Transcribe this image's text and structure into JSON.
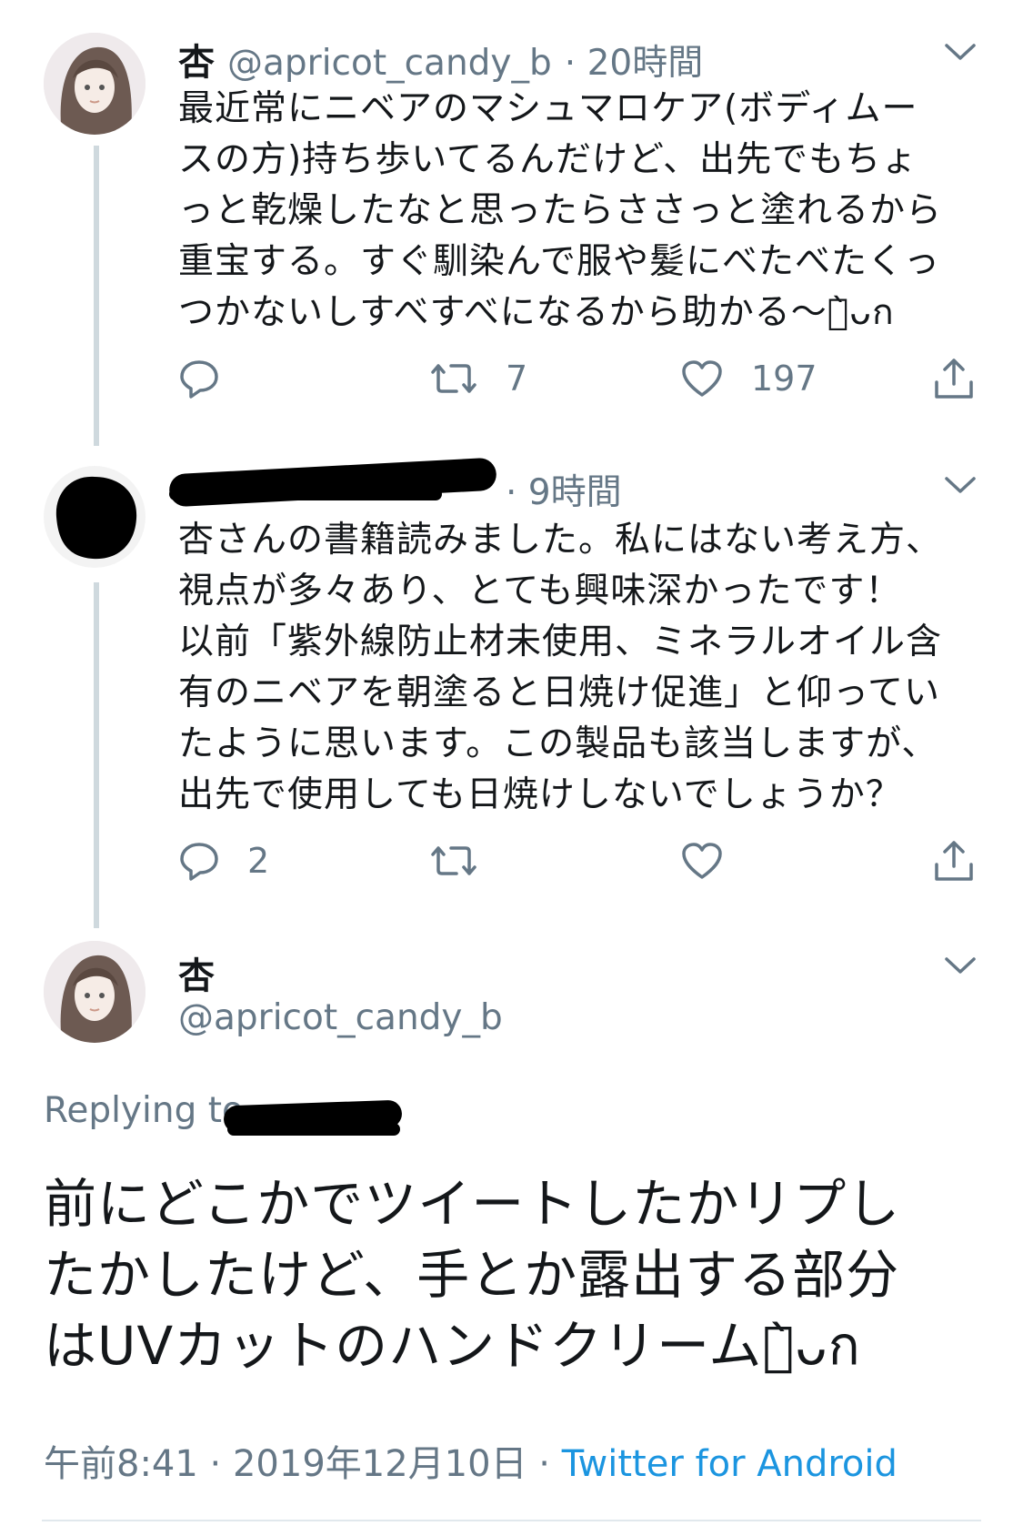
{
  "tweet1": {
    "name": "杏",
    "handle": "@apricot_candy_b",
    "time": "· 20時間",
    "text": "最近常にニベアのマシュマロケア(ボディムー\nスの方)持ち歩いてるんだけど、出先でもちょ\nっと乾燥したなと思ったらささっと塗れるから\n重宝する。すぐ馴染んで服や髪にべたべたくっ\nつかないしすべすべになるから助かる〜ก̀ᴗก",
    "replies": "",
    "retweets": "7",
    "likes": "197"
  },
  "tweet2": {
    "time": "· 9時間",
    "text": "杏さんの書籍読みました。私にはない考え方、\n視点が多々あり、とても興味深かったです！\n以前「紫外線防止材未使用、ミネラルオイル含\n有のニベアを朝塗ると日焼け促進」と仰ってい\nたように思います。この製品も該当しますが、\n出先で使用しても日焼けしないでしょうか？",
    "replies": "2",
    "retweets": "",
    "likes": ""
  },
  "main_tweet": {
    "name": "杏",
    "handle": "@apricot_candy_b",
    "replying_to": "Replying to",
    "text": "前にどこかでツイートしたかリプし\nたかしたけど、手とか露出する部分\nはUVカットのハンドクリームก̀ᴗก",
    "time": "午前8:41",
    "date": "· 2019年12月10日",
    "source_sep": "·",
    "source": "Twitter for Android"
  },
  "icons": [
    "chevron-down-icon",
    "reply-icon",
    "retweet-icon",
    "like-icon",
    "share-icon"
  ],
  "colors": {
    "secondary": "#657786",
    "link": "#1b95e0",
    "thread_line": "#cfd9de"
  }
}
